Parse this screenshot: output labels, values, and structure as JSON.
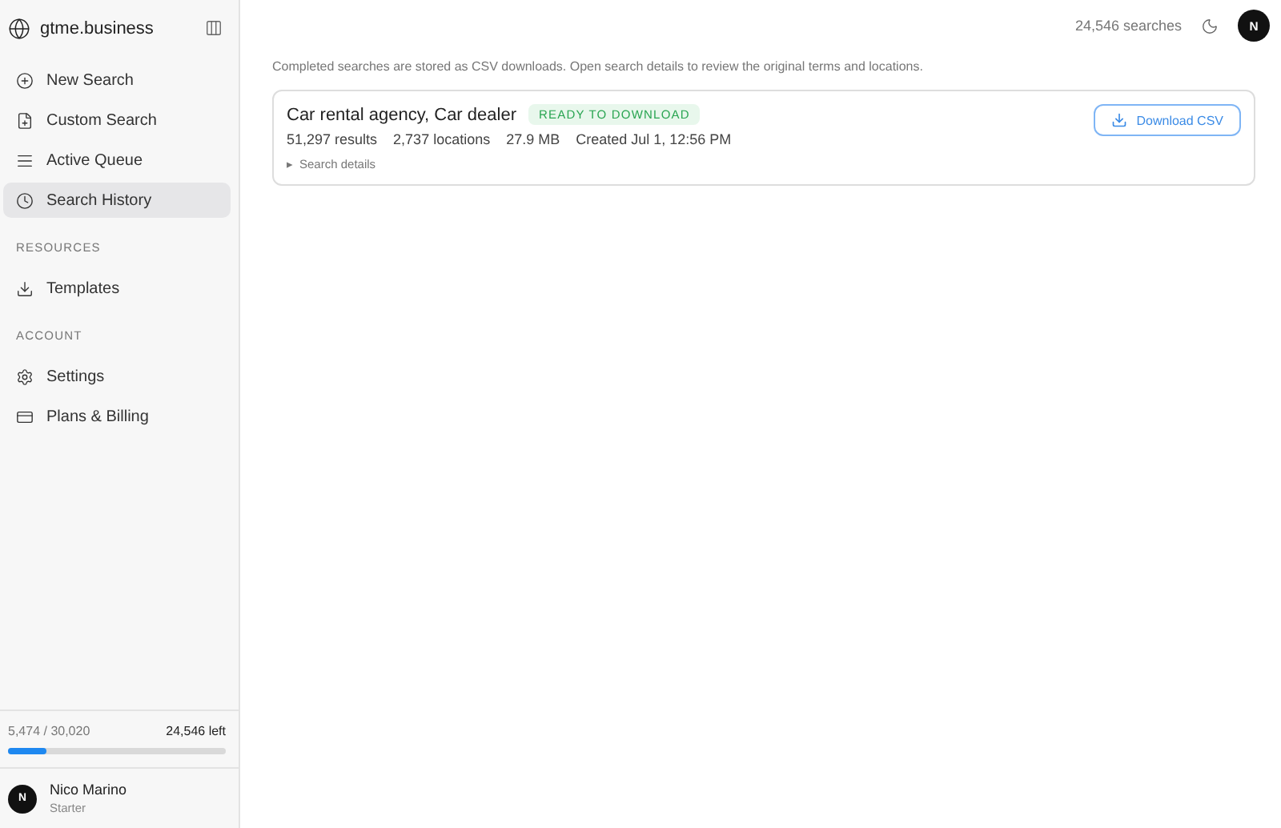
{
  "brand": {
    "name": "gtme.business"
  },
  "nav": [
    {
      "label": "New Search",
      "kind": "plus",
      "selected": false
    },
    {
      "label": "Custom Search",
      "kind": "file",
      "selected": false
    },
    {
      "label": "Active Queue",
      "kind": "queue",
      "selected": false
    },
    {
      "label": "Search History",
      "kind": "clock",
      "selected": true
    }
  ],
  "sections": [
    {
      "title": "RESOURCES",
      "items": [
        {
          "label": "Templates",
          "kind": "download",
          "selected": false
        }
      ]
    },
    {
      "title": "ACCOUNT",
      "items": [
        {
          "label": "Settings",
          "kind": "gear",
          "selected": false
        },
        {
          "label": "Plans & Billing",
          "kind": "card",
          "selected": false
        }
      ]
    }
  ],
  "usage": {
    "used": "5,474 / 30,020",
    "left": "24,546 left",
    "level": 0.18
  },
  "user": {
    "initial": "N",
    "name": "Nico Marino",
    "plan": "Starter"
  },
  "header": {
    "searches": "24,546 searches",
    "avatar": "N"
  },
  "intro": "Completed searches are stored as CSV downloads. Open search details to review the original terms and locations.",
  "history": [
    {
      "title": "Car rental agency, Car dealer",
      "status": "READY TO DOWNLOAD",
      "stats": [
        "51,297 results",
        "2,737 locations",
        "27.9 MB",
        "Created Jul 1, 12:56 PM"
      ],
      "details_marker": "▸",
      "details": "Search details",
      "download": "Download CSV"
    }
  ]
}
